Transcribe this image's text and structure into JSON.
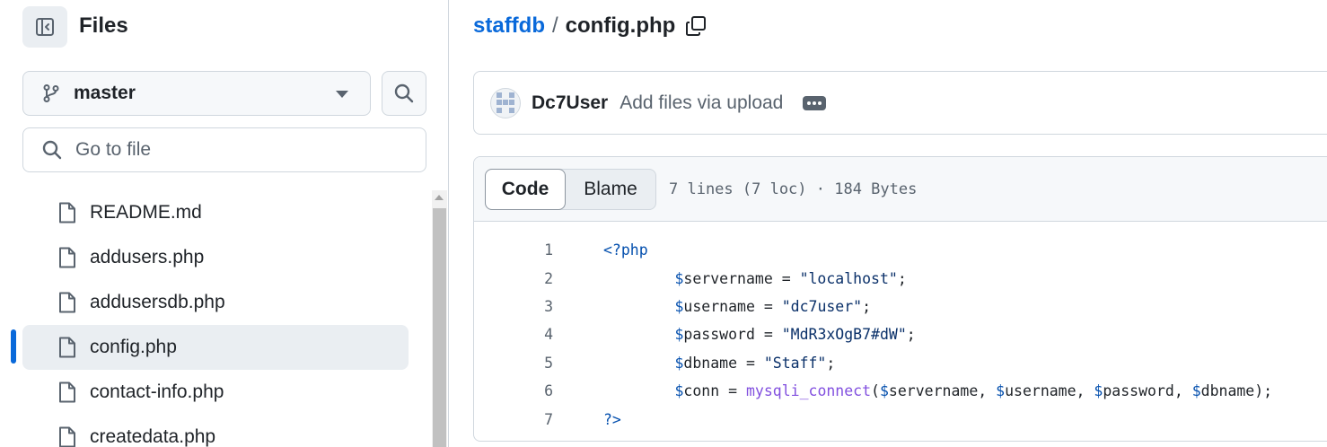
{
  "sidebar": {
    "title": "Files",
    "branch": "master",
    "goto_placeholder": "Go to file",
    "files": [
      {
        "name": "README.md",
        "active": false
      },
      {
        "name": "addusers.php",
        "active": false
      },
      {
        "name": "addusersdb.php",
        "active": false
      },
      {
        "name": "config.php",
        "active": true
      },
      {
        "name": "contact-info.php",
        "active": false
      },
      {
        "name": "createdata.php",
        "active": false
      }
    ]
  },
  "breadcrumb": {
    "repo": "staffdb",
    "separator": "/",
    "file": "config.php"
  },
  "commit": {
    "author": "Dc7User",
    "message": "Add files via upload"
  },
  "code_view": {
    "tabs": [
      "Code",
      "Blame"
    ],
    "active_tab": "Code",
    "meta": "7 lines (7 loc) · 184 Bytes",
    "line_numbers": [
      "1",
      "2",
      "3",
      "4",
      "5",
      "6",
      "7"
    ]
  },
  "colors": {
    "link": "#0969da",
    "active_indicator": "#0969da",
    "border": "#d0d7de",
    "muted_text": "#59636e"
  }
}
